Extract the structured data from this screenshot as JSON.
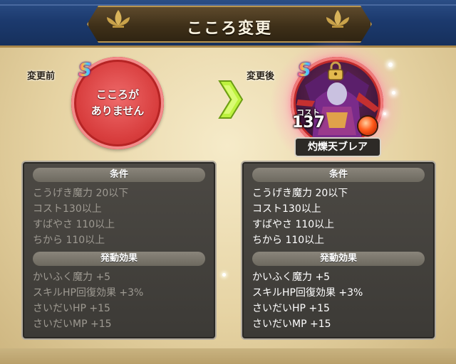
{
  "header": {
    "title": "こころ変更"
  },
  "before": {
    "label": "変更前",
    "rank": "S",
    "empty_text": [
      "こころが",
      "ありません"
    ]
  },
  "after": {
    "label": "変更後",
    "rank": "S",
    "cost_label": "コスト",
    "cost_value": "137",
    "name": "灼爍天ブレア"
  },
  "conditions_header": "条件",
  "effects_header": "発動効果",
  "left_panel": {
    "conditions": [
      "こうげき魔力 20以下",
      "コスト130以上",
      "すばやさ 110以上",
      "ちから 110以上"
    ],
    "effects": [
      "かいふく魔力 +5",
      "スキルHP回復効果 +3%",
      "さいだいHP +15",
      "さいだいMP +15"
    ]
  },
  "right_panel": {
    "conditions": [
      "こうげき魔力 20以下",
      "コスト130以上",
      "すばやさ 110以上",
      "ちから 110以上"
    ],
    "effects": [
      "かいふく魔力 +5",
      "スキルHP回復効果 +3%",
      "さいだいHP +15",
      "さいだいMP +15"
    ]
  },
  "colors": {
    "header_blue": "#1c3a6e",
    "disc_red": "#d83d3d",
    "panel_dark": "#3c3a36",
    "arrow_green": "#b8f03c"
  },
  "icons": [
    "fleur-de-lis-icon",
    "arrow-right-icon",
    "lock-icon",
    "element-orb-icon"
  ]
}
